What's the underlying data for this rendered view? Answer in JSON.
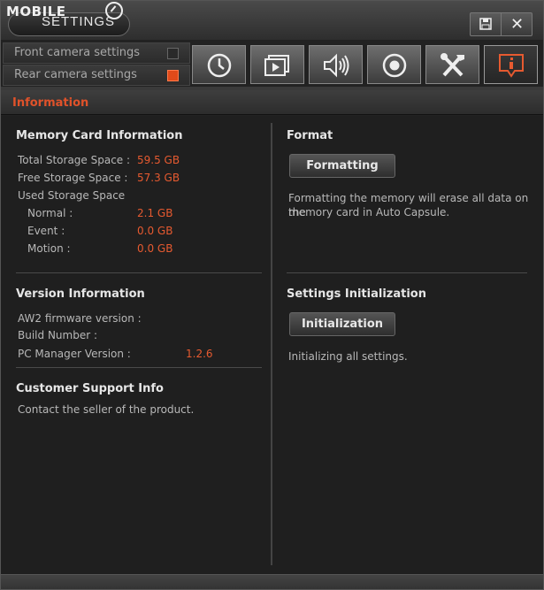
{
  "app": {
    "logo_top": "MOBILE",
    "logo_sub": "SETTINGS"
  },
  "window_controls": {
    "save_icon": "save-icon",
    "close_label": "✕"
  },
  "camera_selector": {
    "front_label": "Front camera settings",
    "rear_label": "Rear camera settings",
    "active": "rear"
  },
  "tabs": [
    {
      "icon": "clock-icon"
    },
    {
      "icon": "video-icon"
    },
    {
      "icon": "speaker-icon"
    },
    {
      "icon": "record-icon"
    },
    {
      "icon": "tools-icon"
    },
    {
      "icon": "info-icon",
      "active": true
    }
  ],
  "section": {
    "title": "Information"
  },
  "memory": {
    "title": "Memory Card Information",
    "total_label": "Total Storage Space :",
    "total_value": "59.5 GB",
    "free_label": "Free Storage Space :",
    "free_value": "57.3 GB",
    "used_label": "Used Storage Space",
    "normal_label": "Normal :",
    "normal_value": "2.1 GB",
    "event_label": "Event :",
    "event_value": "0.0 GB",
    "motion_label": "Motion :",
    "motion_value": "0.0 GB"
  },
  "version": {
    "title": "Version Information",
    "firmware_label": "AW2 firmware version :",
    "build_label": "Build Number :",
    "pc_label": "PC Manager Version :",
    "pc_value": "1.2.6"
  },
  "support": {
    "title": "Customer Support Info",
    "text": "Contact the seller of the product."
  },
  "format": {
    "title": "Format",
    "button": "Formatting",
    "desc_line1": "Formatting the memory will erase all data on the",
    "desc_line2": "memory card in Auto Capsule."
  },
  "init": {
    "title": "Settings Initialization",
    "button": "Initialization",
    "desc": "Initializing all settings."
  },
  "colors": {
    "accent": "#e65a30",
    "background": "#1f1f1f"
  }
}
